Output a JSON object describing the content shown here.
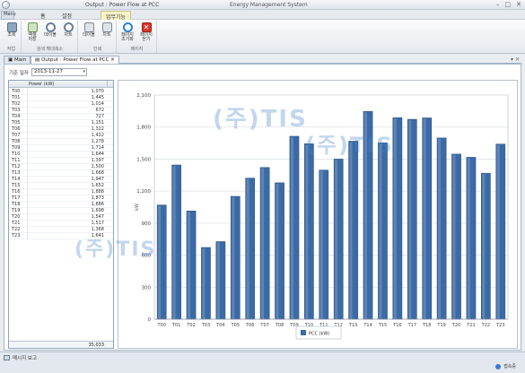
{
  "window": {
    "doc_title": "Output : Power Flow at PCC",
    "app_title": "Energy Management System",
    "min": "–",
    "max": "□",
    "close": "✕"
  },
  "ribbon_tabs": {
    "menu": "Menu",
    "home": "홈",
    "settings": "설정",
    "context": "업무기능"
  },
  "ribbon": {
    "btn_view": "조회",
    "btn_excel": "엑셀\n저장",
    "btn_search": "데이블",
    "btn_chart": "차트",
    "btn_table2": "데이블",
    "btn_chart2": "차트",
    "btn_refresh": "페이지\n초기화",
    "btn_close": "페이지\n닫기",
    "group_query": "작업",
    "group_zoom": "검색 확대축소",
    "group_print": "인쇄",
    "group_page": "페이지"
  },
  "doc_tabs": {
    "main": "Main",
    "output": "Output : Power Flow at PCC"
  },
  "filter": {
    "label": "기준 일자",
    "date": "2013-11-27"
  },
  "grid": {
    "column": "Power (kW)",
    "total": "35,033",
    "rows": [
      {
        "hour": "T00",
        "value": "1,070"
      },
      {
        "hour": "T01",
        "value": "1,445"
      },
      {
        "hour": "T02",
        "value": "1,014"
      },
      {
        "hour": "T03",
        "value": "672"
      },
      {
        "hour": "T04",
        "value": "727"
      },
      {
        "hour": "T05",
        "value": "1,151"
      },
      {
        "hour": "T06",
        "value": "1,322"
      },
      {
        "hour": "T07",
        "value": "1,422"
      },
      {
        "hour": "T08",
        "value": "1,278"
      },
      {
        "hour": "T09",
        "value": "1,714"
      },
      {
        "hour": "T10",
        "value": "1,644"
      },
      {
        "hour": "T11",
        "value": "1,397"
      },
      {
        "hour": "T12",
        "value": "1,500"
      },
      {
        "hour": "T13",
        "value": "1,668"
      },
      {
        "hour": "T14",
        "value": "1,947"
      },
      {
        "hour": "T15",
        "value": "1,652"
      },
      {
        "hour": "T16",
        "value": "1,888"
      },
      {
        "hour": "T17",
        "value": "1,873"
      },
      {
        "hour": "T18",
        "value": "1,886"
      },
      {
        "hour": "T19",
        "value": "1,698"
      },
      {
        "hour": "T20",
        "value": "1,547"
      },
      {
        "hour": "T21",
        "value": "1,517"
      },
      {
        "hour": "T22",
        "value": "1,368"
      },
      {
        "hour": "T23",
        "value": "1,641"
      }
    ]
  },
  "chart_data": {
    "type": "bar",
    "categories": [
      "T00",
      "T01",
      "T02",
      "T03",
      "T04",
      "T05",
      "T06",
      "T07",
      "T08",
      "T09",
      "T10",
      "T11",
      "T12",
      "T13",
      "T14",
      "T15",
      "T16",
      "T17",
      "T18",
      "T19",
      "T20",
      "T21",
      "T22",
      "T23"
    ],
    "series": [
      {
        "name": "PCC (kW)",
        "values": [
          1070,
          1445,
          1014,
          672,
          727,
          1151,
          1322,
          1422,
          1278,
          1714,
          1644,
          1397,
          1500,
          1668,
          1947,
          1652,
          1888,
          1873,
          1886,
          1698,
          1547,
          1517,
          1368,
          1641
        ]
      }
    ],
    "yticks": [
      "0",
      "300",
      "600",
      "900",
      "1,200",
      "1,500",
      "1,800",
      "2,100"
    ],
    "ylim": [
      0,
      2100
    ],
    "ylabel": "kW",
    "grid": true,
    "legend": "bottom-center",
    "bar_color": "#3b6aa5"
  },
  "watermark": {
    "text": "(주)TIS"
  },
  "status": {
    "message": "메시지 보고",
    "connection": "접속중"
  },
  "colors": {
    "bar": "#3b6aa5",
    "accent": "#2f6fbf"
  }
}
